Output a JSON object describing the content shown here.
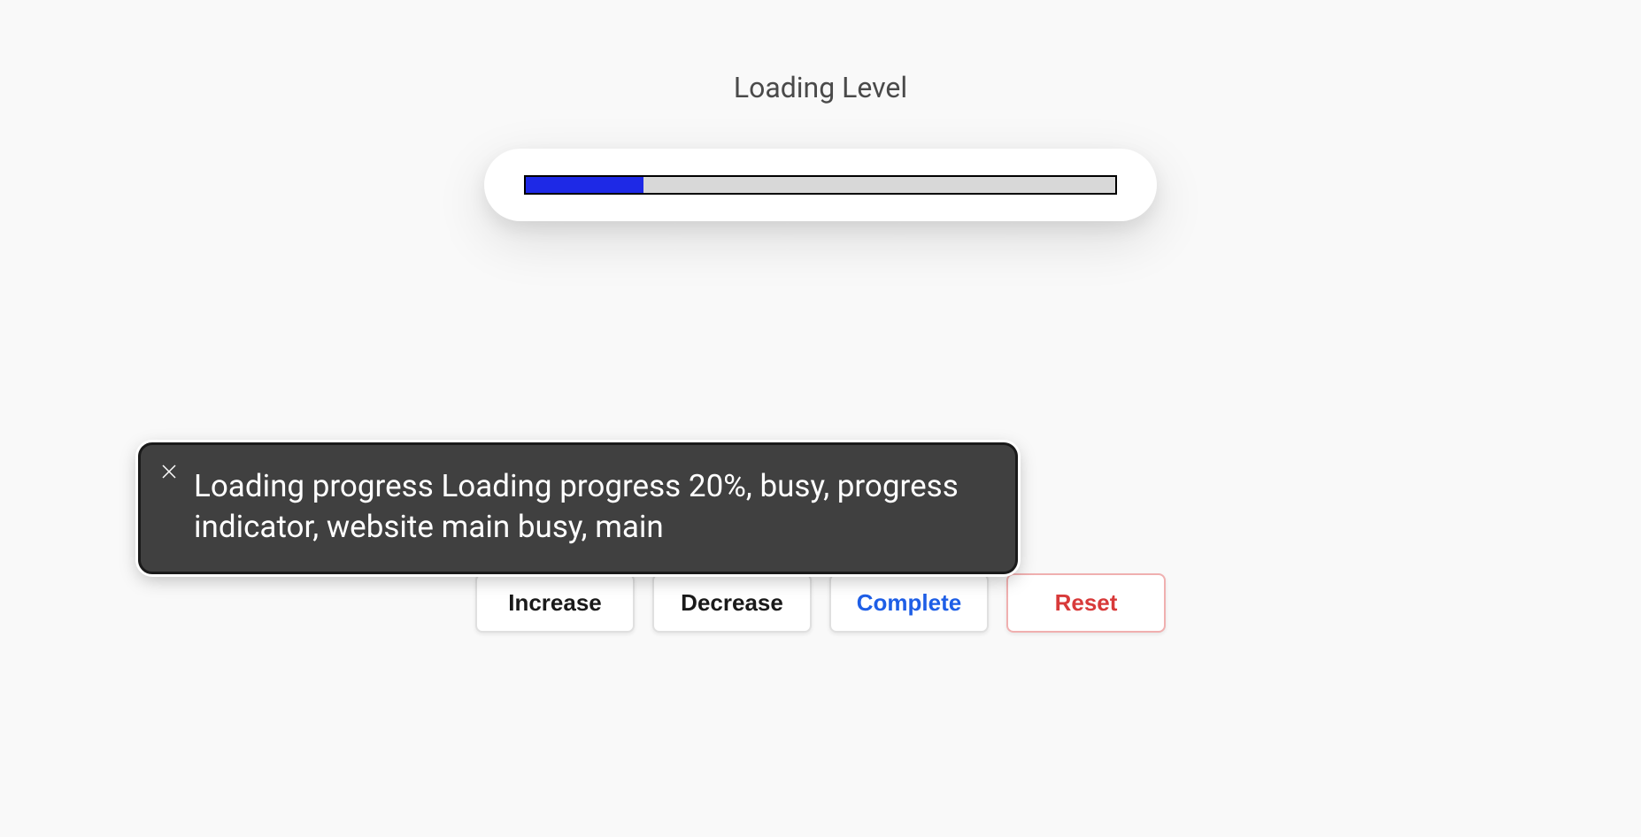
{
  "title": "Loading Level",
  "progress": {
    "percent": 20
  },
  "buttons": {
    "increase": "Increase",
    "decrease": "Decrease",
    "complete": "Complete",
    "reset": "Reset"
  },
  "tooltip": {
    "text": "Loading progress Loading progress 20%, busy, progress indicator, website main busy, main",
    "close_label": "Close"
  }
}
